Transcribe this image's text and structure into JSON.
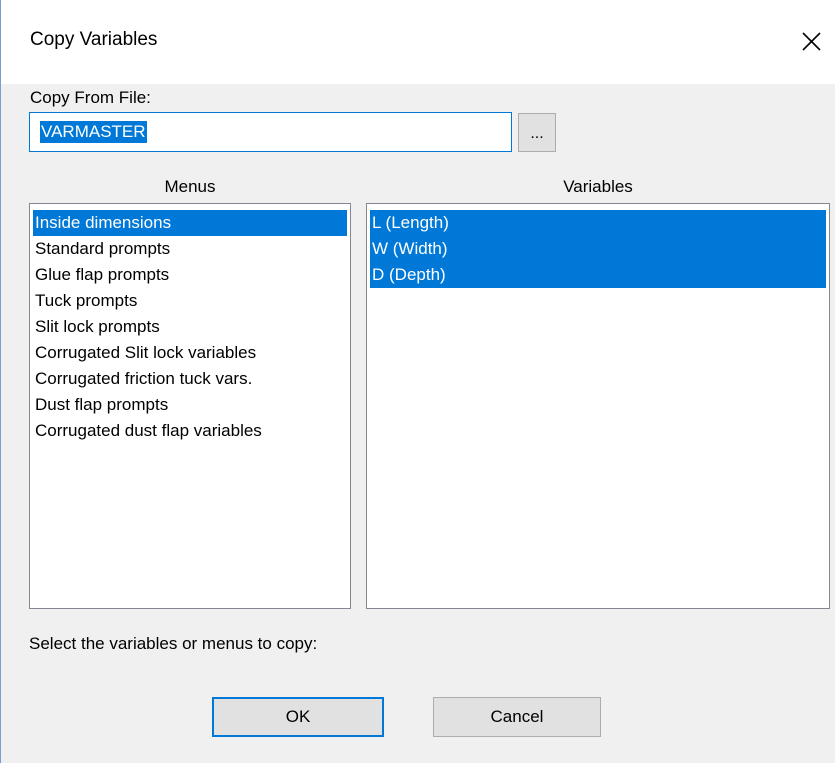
{
  "window": {
    "title": "Copy Variables",
    "close_glyph": "✕"
  },
  "copy_from": {
    "label": "Copy From File:",
    "value": "VARMASTER",
    "browse_label": "..."
  },
  "menus": {
    "header": "Menus",
    "items": [
      "Inside dimensions",
      "Standard prompts",
      "Glue flap prompts",
      "Tuck prompts",
      "Slit lock prompts",
      "Corrugated Slit lock variables",
      "Corrugated friction tuck vars.",
      "Dust flap prompts",
      "Corrugated dust flap variables"
    ],
    "selected": [
      "Inside dimensions"
    ]
  },
  "variables": {
    "header": "Variables",
    "items": [
      "L (Length)",
      "W (Width)",
      "D (Depth)"
    ],
    "selected": [
      "L (Length)",
      "W (Width)",
      "D (Depth)"
    ]
  },
  "instruction": "Select the variables or menus to copy:",
  "buttons": {
    "ok": "OK",
    "cancel": "Cancel"
  },
  "colors": {
    "selection": "#0078d7",
    "dialog_bg": "#f0f0f0",
    "title_bg": "#ffffff"
  }
}
